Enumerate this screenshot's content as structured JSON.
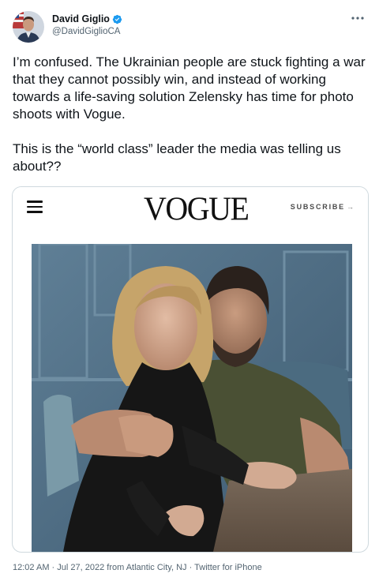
{
  "user": {
    "display_name": "David Giglio",
    "handle": "@DavidGiglioCA",
    "verified": true
  },
  "tweet": {
    "text": "I’m confused. The Ukrainian people are stuck fighting a war that they cannot possibly win, and instead of working towards a life-saving solution Zelensky has time for photo shoots with Vogue.\n\nThis is the “world class” leader the media was telling us about??"
  },
  "media": {
    "logo": "VOGUE",
    "subscribe_label": "SUBSCRIBE",
    "subscribe_arrow": "→"
  },
  "meta": {
    "time": "12:02 AM",
    "date": "Jul 27, 2022 from Atlantic City, NJ",
    "source": "Twitter for iPhone",
    "separator": "·"
  },
  "icons": {
    "verified": "verified-badge-icon",
    "more": "more-options-icon",
    "menu": "hamburger-menu-icon"
  },
  "colors": {
    "text": "#0f1419",
    "secondary": "#536471",
    "verified_blue": "#1d9bf0",
    "border": "#cfd9de"
  }
}
